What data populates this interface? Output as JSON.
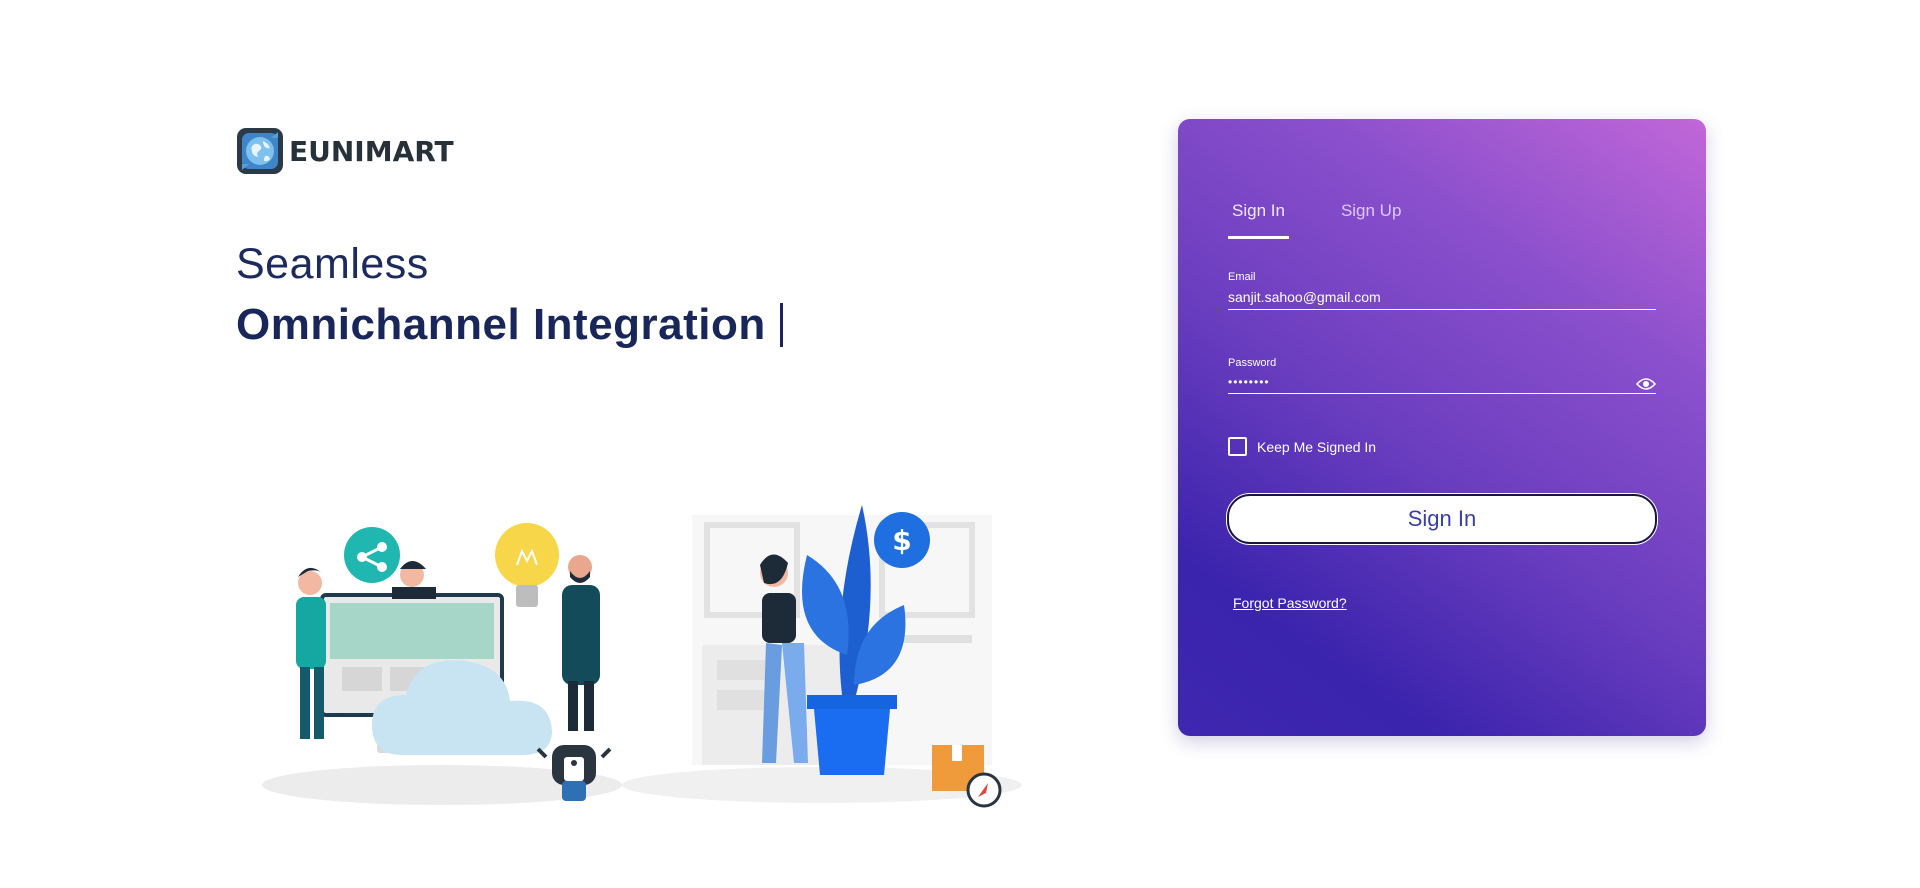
{
  "brand": {
    "name": "EUNIMART",
    "logo_icon": "globe-icon"
  },
  "hero": {
    "line1": "Seamless",
    "line2": "Omnichannel Integration"
  },
  "illustration": {
    "icon": "team-collaboration-illustration"
  },
  "login": {
    "tabs": [
      {
        "label": "Sign In",
        "active": true
      },
      {
        "label": "Sign Up",
        "active": false
      }
    ],
    "email": {
      "label": "Email",
      "value": "sanjit.sahoo@gmail.com"
    },
    "password": {
      "label": "Password",
      "value": "••••••••",
      "toggle_icon": "eye-icon"
    },
    "keep_signed_in": {
      "label": "Keep Me Signed In",
      "checked": false
    },
    "submit_label": "Sign In",
    "forgot_label": "Forgot Password?"
  },
  "colors": {
    "gradient_start": "#c167d8",
    "gradient_end": "#3a23ad",
    "headline": "#18265a"
  }
}
